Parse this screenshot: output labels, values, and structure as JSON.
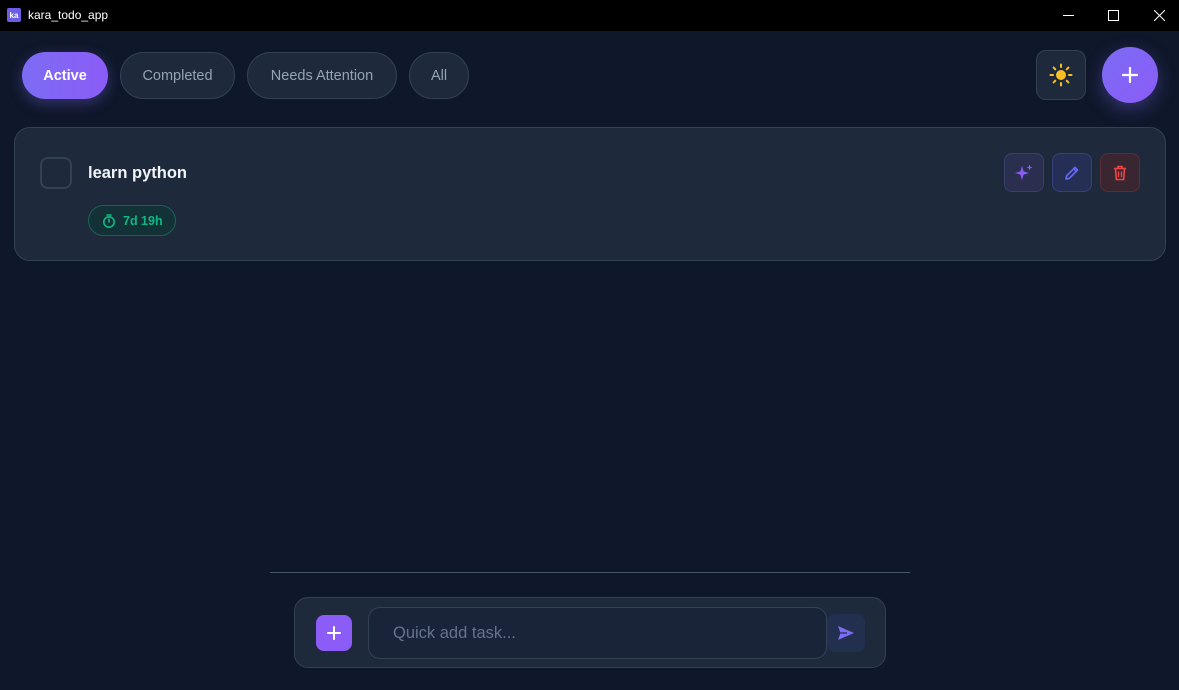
{
  "window": {
    "title": "kara_todo_app",
    "icon_label": "ka",
    "minimize_icon": "minimize-icon",
    "maximize_icon": "maximize-icon",
    "close_icon": "close-icon"
  },
  "filters": [
    {
      "label": "Active",
      "selected": true
    },
    {
      "label": "Completed",
      "selected": false
    },
    {
      "label": "Needs Attention",
      "selected": false
    },
    {
      "label": "All",
      "selected": false
    }
  ],
  "header_actions": {
    "theme_icon": "sun-icon",
    "add_icon": "plus-icon"
  },
  "tasks": [
    {
      "title": "learn python",
      "completed": false,
      "time_remaining": "7d 19h",
      "badge_icon": "timer-icon",
      "actions": [
        "sparkle-icon",
        "pencil-icon",
        "trash-icon"
      ]
    }
  ],
  "quick_add": {
    "placeholder": "Quick add task...",
    "value": "",
    "add_icon": "plus-icon",
    "send_icon": "send-icon"
  },
  "colors": {
    "background": "#0f172a",
    "surface": "#1e293b",
    "border": "#334155",
    "accent": "#8b5cf6",
    "success": "#10b981",
    "danger": "#ef4444",
    "sun": "#fbbf24"
  }
}
